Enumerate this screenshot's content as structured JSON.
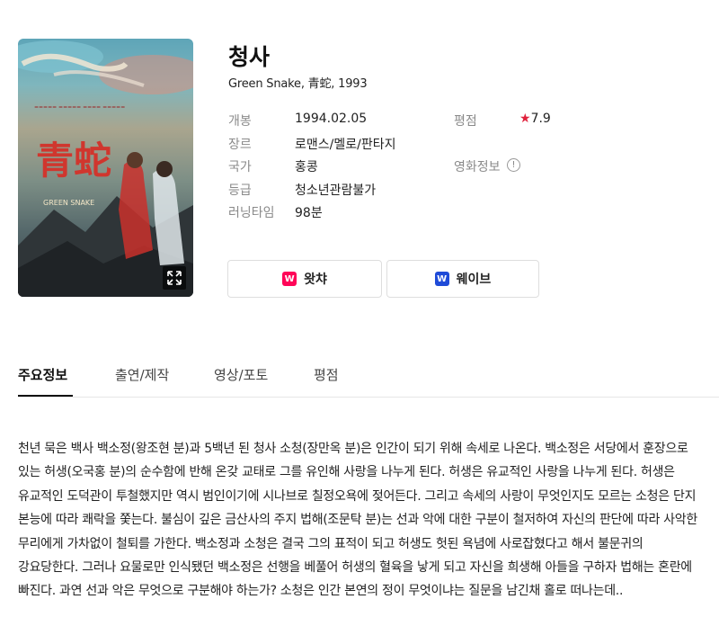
{
  "movie": {
    "title": "청사",
    "subtitle": "Green Snake, 青蛇, 1993"
  },
  "info": {
    "release_label": "개봉",
    "release_value": "1994.02.05",
    "genre_label": "장르",
    "genre_value": "로맨스/멜로/판타지",
    "country_label": "국가",
    "country_value": "홍콩",
    "grade_label": "등급",
    "grade_value": "청소년관람불가",
    "runtime_label": "러닝타임",
    "runtime_value": "98분",
    "rating_label": "평점",
    "rating_value": "7.9",
    "rating_star": "★",
    "movieinfo_label": "영화정보",
    "movieinfo_icon": "!"
  },
  "ott": [
    {
      "label": "왓챠",
      "logo_letter": "W",
      "color": "#ff0558",
      "icon": "watcha-icon"
    },
    {
      "label": "웨이브",
      "logo_letter": "W",
      "color": "#1f4bd8",
      "icon": "wavve-icon"
    }
  ],
  "tabs": [
    "주요정보",
    "출연/제작",
    "영상/포토",
    "평점"
  ],
  "active_tab": "주요정보",
  "poster": {
    "title_text": "青蛇",
    "english_text": "GREEN SNAKE",
    "expand_icon": "expand-icon"
  },
  "synopsis": "천년 묵은 백사 백소정(왕조현 분)과 5백년 된 청사 소청(장만옥 분)은 인간이 되기 위해 속세로 나온다. 백소정은 서당에서 훈장으로 있는 허생(오국홍 분)의 순수함에 반해 온갖 교태로 그를 유인해 사랑을 나누게 된다. 허생은 유교적인 사랑을 나누게 된다. 허생은 유교적인 도덕관이 투철했지만 역시 범인이기에 시나브로 칠정오욕에 젖어든다. 그리고 속세의 사랑이 무엇인지도 모르는 소청은 단지 본능에 따라 쾌락을 쫓는다. 불심이 깊은 금산사의 주지 법해(조문탁 분)는 선과 악에 대한 구분이 철저하여 자신의 판단에 따라 사악한 무리에게 가차없이 철퇴를 가한다. 백소정과 소청은 결국 그의 표적이 되고 허생도 헛된 욕념에 사로잡혔다고 해서 불문귀의 강요당한다. 그러나 요물로만 인식됐던 백소정은 선행을 베풀어 허생의 혈육을 낳게 되고 자신을 희생해 아들을 구하자 법해는 혼란에 빠진다. 과연 선과 악은 무엇으로 구분해야 하는가? 소청은 인간 본연의 정이 무엇이냐는 질문을 남긴채 홀로 떠나는데.."
}
